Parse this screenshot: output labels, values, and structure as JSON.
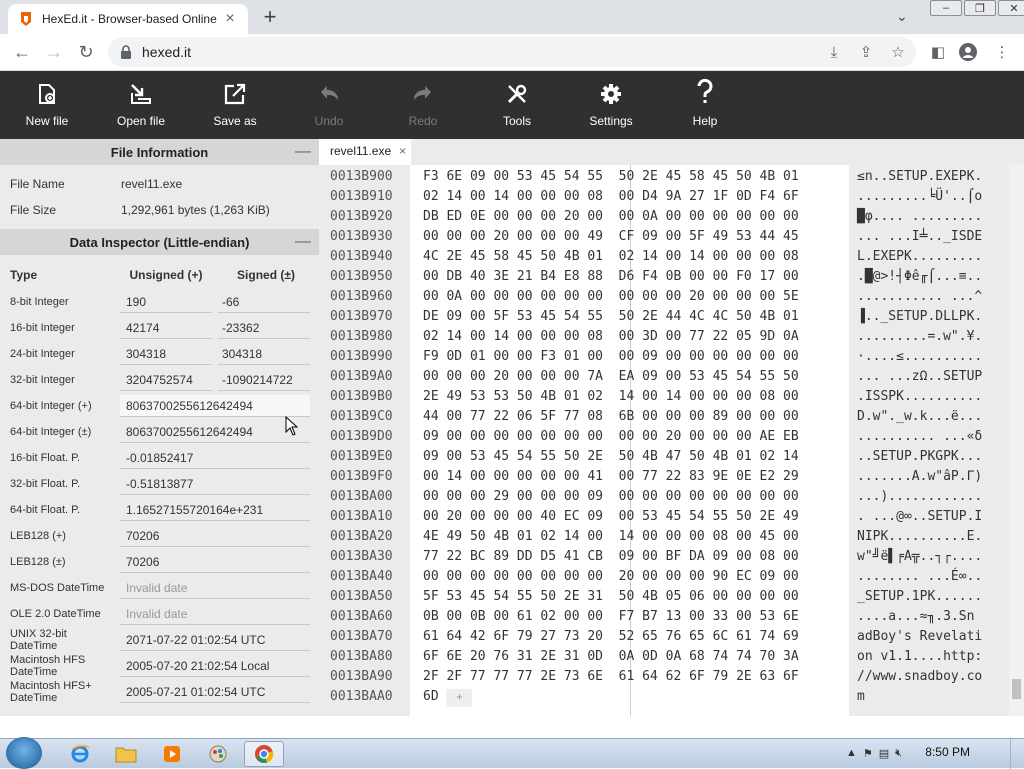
{
  "browser": {
    "tab_title": "HexEd.it - Browser-based Online",
    "url": "hexed.it",
    "new_tab_symbol": "+",
    "close_symbol": "×"
  },
  "app_toolbar": {
    "buttons": [
      {
        "label": "New file",
        "icon": "new-file-icon",
        "enabled": true
      },
      {
        "label": "Open file",
        "icon": "open-file-icon",
        "enabled": true
      },
      {
        "label": "Save as",
        "icon": "save-as-icon",
        "enabled": true
      },
      {
        "label": "Undo",
        "icon": "undo-icon",
        "enabled": false
      },
      {
        "label": "Redo",
        "icon": "redo-icon",
        "enabled": false
      },
      {
        "label": "Tools",
        "icon": "tools-icon",
        "enabled": true
      },
      {
        "label": "Settings",
        "icon": "settings-icon",
        "enabled": true
      },
      {
        "label": "Help",
        "icon": "help-icon",
        "enabled": true
      }
    ]
  },
  "file_info": {
    "title": "File Information",
    "collapse_symbol": "—",
    "name_label": "File Name",
    "name_value": "revel11.exe",
    "size_label": "File Size",
    "size_value": "1,292,961 bytes (1,263 KiB)"
  },
  "data_inspector": {
    "title": "Data Inspector (Little-endian)",
    "collapse_symbol": "—",
    "col_type": "Type",
    "col_unsigned": "Unsigned (+)",
    "col_signed": "Signed (±)",
    "rows": [
      {
        "type": "8-bit Integer",
        "unsigned": "190",
        "signed": "-66"
      },
      {
        "type": "16-bit Integer",
        "unsigned": "42174",
        "signed": "-23362"
      },
      {
        "type": "24-bit Integer",
        "unsigned": "304318",
        "signed": "304318"
      },
      {
        "type": "32-bit Integer",
        "unsigned": "3204752574",
        "signed": "-1090214722"
      }
    ],
    "wide_rows": [
      {
        "type": "64-bit Integer (+)",
        "value": "8063700255612642494"
      },
      {
        "type": "64-bit Integer (±)",
        "value": "8063700255612642494"
      },
      {
        "type": "16-bit Float. P.",
        "value": "-0.01852417"
      },
      {
        "type": "32-bit Float. P.",
        "value": "-0.51813877"
      },
      {
        "type": "64-bit Float. P.",
        "value": "1.16527155720164e+231"
      },
      {
        "type": "LEB128 (+)",
        "value": "70206"
      },
      {
        "type": "LEB128 (±)",
        "value": "70206"
      },
      {
        "type": "MS-DOS DateTime",
        "value": "Invalid date",
        "muted": true
      },
      {
        "type": "OLE 2.0 DateTime",
        "value": "Invalid date",
        "muted": true
      },
      {
        "type": "UNIX 32-bit DateTime",
        "value": "2071-07-22 01:02:54 UTC"
      },
      {
        "type": "Macintosh HFS DateTime",
        "value": "2005-07-20 21:02:54 Local"
      },
      {
        "type": "Macintosh HFS+ DateTime",
        "value": "2005-07-21 01:02:54 UTC"
      }
    ]
  },
  "hex_editor": {
    "file_tab": "revel11.exe",
    "file_tab_close": "×",
    "rows": [
      {
        "addr": "0013B900",
        "bytes": "F3 6E 09 00 53 45 54 55  50 2E 45 58 45 50 4B 01",
        "ascii": "≤n..SETUP.EXEPK."
      },
      {
        "addr": "0013B910",
        "bytes": "02 14 00 14 00 00 00 08  00 D4 9A 27 1F 0D F4 6F",
        "ascii": ".........╘Ü'..⌠o"
      },
      {
        "addr": "0013B920",
        "bytes": "DB ED 0E 00 00 00 20 00  00 0A 00 00 00 00 00 00",
        "ascii": "█φ.... ........."
      },
      {
        "addr": "0013B930",
        "bytes": "00 00 00 20 00 00 00 49  CF 09 00 5F 49 53 44 45",
        "ascii": "... ...I╧.._ISDE"
      },
      {
        "addr": "0013B940",
        "bytes": "4C 2E 45 58 45 50 4B 01  02 14 00 14 00 00 00 08",
        "ascii": "L.EXEPK........."
      },
      {
        "addr": "0013B950",
        "bytes": "00 DB 40 3E 21 B4 E8 88  D6 F4 0B 00 00 F0 17 00",
        "ascii": ".█@>!┤Φê╓⌠...≡.."
      },
      {
        "addr": "0013B960",
        "bytes": "00 0A 00 00 00 00 00 00  00 00 00 20 00 00 00 5E",
        "ascii": "........... ...^"
      },
      {
        "addr": "0013B970",
        "bytes": "DE 09 00 5F 53 45 54 55  50 2E 44 4C 4C 50 4B 01",
        "ascii": "▐.._SETUP.DLLPK."
      },
      {
        "addr": "0013B980",
        "bytes": "02 14 00 14 00 00 00 08  00 3D 00 77 22 05 9D 0A",
        "ascii": ".........=.w\".¥."
      },
      {
        "addr": "0013B990",
        "bytes": "F9 0D 01 00 00 F3 01 00  00 09 00 00 00 00 00 00",
        "ascii": "·....≤.........."
      },
      {
        "addr": "0013B9A0",
        "bytes": "00 00 00 20 00 00 00 7A  EA 09 00 53 45 54 55 50",
        "ascii": "... ...zΩ..SETUP"
      },
      {
        "addr": "0013B9B0",
        "bytes": "2E 49 53 53 50 4B 01 02  14 00 14 00 00 00 08 00",
        "ascii": ".ISSPK.........."
      },
      {
        "addr": "0013B9C0",
        "bytes": "44 00 77 22 06 5F 77 08  6B 00 00 00 89 00 00 00",
        "ascii": "D.w\"._w.k...ë..."
      },
      {
        "addr": "0013B9D0",
        "bytes": "09 00 00 00 00 00 00 00  00 00 20 00 00 00 AE EB",
        "ascii": ".......... ...«δ"
      },
      {
        "addr": "0013B9E0",
        "bytes": "09 00 53 45 54 55 50 2E  50 4B 47 50 4B 01 02 14",
        "ascii": "..SETUP.PKGPK..."
      },
      {
        "addr": "0013B9F0",
        "bytes": "00 14 00 00 00 00 00 41  00 77 22 83 9E 0E E2 29",
        "ascii": ".......A.w\"âP.Γ)"
      },
      {
        "addr": "0013BA00",
        "bytes": "00 00 00 29 00 00 00 09  00 00 00 00 00 00 00 00",
        "ascii": "...)............"
      },
      {
        "addr": "0013BA10",
        "bytes": "00 20 00 00 00 40 EC 09  00 53 45 54 55 50 2E 49",
        "ascii": ". ...@∞..SETUP.I"
      },
      {
        "addr": "0013BA20",
        "bytes": "4E 49 50 4B 01 02 14 00  14 00 00 00 08 00 45 00",
        "ascii": "NIPK..........E."
      },
      {
        "addr": "0013BA30",
        "bytes": "77 22 BC 89 DD D5 41 CB  09 00 BF DA 09 00 08 00",
        "ascii": "w\"╝ë▌╒A╦..┐┌...."
      },
      {
        "addr": "0013BA40",
        "bytes": "00 00 00 00 00 00 00 00  20 00 00 00 90 EC 09 00",
        "ascii": "........ ...É∞.."
      },
      {
        "addr": "0013BA50",
        "bytes": "5F 53 45 54 55 50 2E 31  50 4B 05 06 00 00 00 00",
        "ascii": "_SETUP.1PK......"
      },
      {
        "addr": "0013BA60",
        "bytes": "0B 00 0B 00 61 02 00 00  F7 B7 13 00 33 00 53 6E",
        "ascii": "....a...≈╖.3.Sn"
      },
      {
        "addr": "0013BA70",
        "bytes": "61 64 42 6F 79 27 73 20  52 65 76 65 6C 61 74 69",
        "ascii": "adBoy's Revelati"
      },
      {
        "addr": "0013BA80",
        "bytes": "6F 6E 20 76 31 2E 31 0D  0A 0D 0A 68 74 74 70 3A",
        "ascii": "on v1.1....http:"
      },
      {
        "addr": "0013BA90",
        "bytes": "2F 2F 77 77 77 2E 73 6E  61 64 62 6F 79 2E 63 6F",
        "ascii": "//www.snadboy.co"
      },
      {
        "addr": "0013BAA0",
        "bytes": "6D",
        "ascii": "m",
        "plus": "+"
      }
    ]
  },
  "taskbar": {
    "clock": "8:50 PM"
  }
}
